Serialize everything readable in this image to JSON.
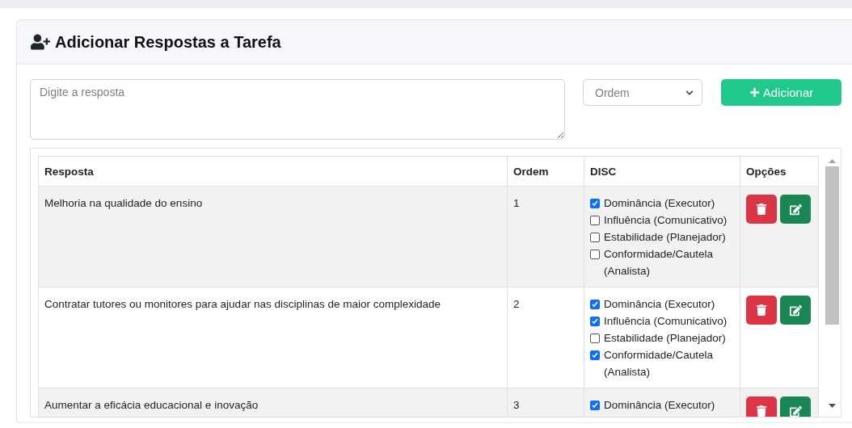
{
  "card": {
    "title": "Adicionar Respostas a Tarefa"
  },
  "form": {
    "answer_placeholder": "Digite a resposta",
    "order_placeholder": "Ordem",
    "add_button": "Adicionar"
  },
  "table": {
    "columns": [
      "Resposta",
      "Ordem",
      "DISC",
      "Opções"
    ],
    "rows": [
      {
        "response": "Melhoria na qualidade do ensino",
        "order": "1",
        "disc": [
          {
            "label": "Dominância (Executor)",
            "checked": true
          },
          {
            "label": "Influência (Comunicativo)",
            "checked": false
          },
          {
            "label": "Estabilidade (Planejador)",
            "checked": false
          },
          {
            "label": "Conformidade/Cautela (Analista)",
            "checked": false
          }
        ]
      },
      {
        "response": "Contratar tutores ou monitores para ajudar nas disciplinas de maior complexidade",
        "order": "2",
        "disc": [
          {
            "label": "Dominância (Executor)",
            "checked": true
          },
          {
            "label": "Influência (Comunicativo)",
            "checked": true
          },
          {
            "label": "Estabilidade (Planejador)",
            "checked": false
          },
          {
            "label": "Conformidade/Cautela (Analista)",
            "checked": true
          }
        ]
      },
      {
        "response": "Aumentar a eficácia educacional e inovação",
        "order": "3",
        "disc": [
          {
            "label": "Dominância (Executor)",
            "checked": true
          }
        ]
      }
    ]
  }
}
